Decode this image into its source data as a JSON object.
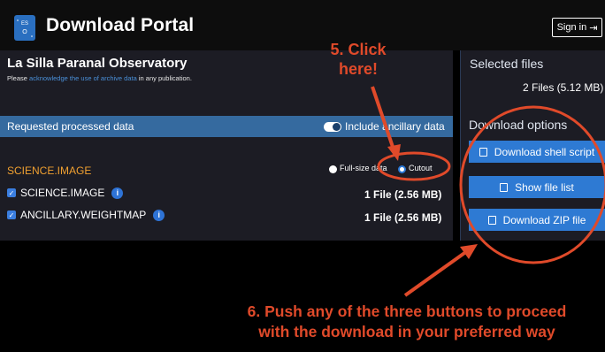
{
  "header": {
    "title": "Download Portal",
    "signin_label": "Sign in"
  },
  "observatory": {
    "title": "La Silla Paranal Observatory",
    "subtitle_prefix": "Please ",
    "subtitle_link": "acknowledge the use of archive data",
    "subtitle_suffix": " in any publication."
  },
  "requested": {
    "label": "Requested processed data",
    "include_ancillary_label": "Include ancillary data",
    "include_ancillary_on": true
  },
  "dataset": {
    "heading": "SCIENCE.IMAGE",
    "mode_options": [
      "Full-size data",
      "Cutout"
    ],
    "mode_selected": "Cutout",
    "rows": [
      {
        "name": "SCIENCE.IMAGE",
        "size": "1 File (2.56 MB)",
        "checked": true
      },
      {
        "name": "ANCILLARY.WEIGHTMAP",
        "size": "1 File (2.56 MB)",
        "checked": true
      }
    ]
  },
  "selected": {
    "title": "Selected files",
    "count": "2 Files (5.12 MB)"
  },
  "download": {
    "title": "Download options",
    "buttons": [
      "Download shell script",
      "Show file list",
      "Download ZIP file"
    ]
  },
  "annotations": {
    "step5_line1": "5. Click",
    "step5_line2": "here!",
    "step6_line1": "6. Push any of the three buttons to proceed",
    "step6_line2": "with the download in your preferred way"
  },
  "colors": {
    "annotation": "#e04a2a",
    "accent": "#2e7ad3",
    "section_bar": "#356a9f",
    "heading_orange": "#f0a030"
  },
  "icons": {
    "logo": "eso-logo",
    "signin": "sign-in-icon",
    "info": "info-icon",
    "checkbox": "checkbox-checked-icon",
    "shell": "file-code-icon",
    "list": "list-icon",
    "zip": "file-zip-icon"
  }
}
